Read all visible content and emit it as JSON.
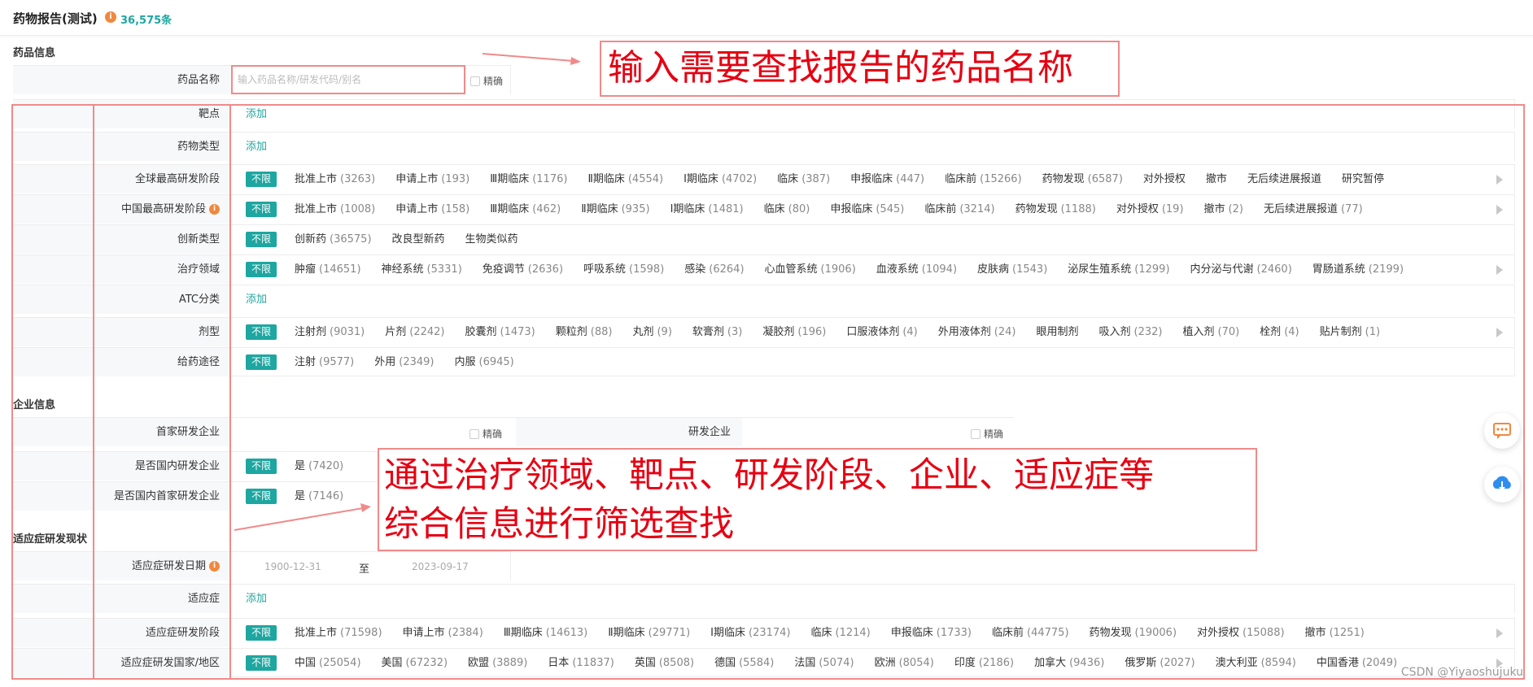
{
  "header": {
    "title": "药物报告(测试)",
    "info_icon": "i",
    "count": "36,575条"
  },
  "sections": {
    "drug_info": "药品信息",
    "company_info": "企业信息",
    "indication_info": "适应症研发现状"
  },
  "drug_name": {
    "label": "药品名称",
    "placeholder": "输入药品名称/研发代码/别名",
    "exact_label": "精确"
  },
  "common": {
    "all_label": "不限",
    "add_label": "添加",
    "to_label": "至"
  },
  "rows": {
    "target": {
      "label": "靶点"
    },
    "drug_type": {
      "label": "药物类型"
    },
    "global_stage": {
      "label": "全球最高研发阶段",
      "options": [
        {
          "name": "批准上市",
          "count": "(3263)"
        },
        {
          "name": "申请上市",
          "count": "(193)"
        },
        {
          "name": "Ⅲ期临床",
          "count": "(1176)"
        },
        {
          "name": "Ⅱ期临床",
          "count": "(4554)"
        },
        {
          "name": "Ⅰ期临床",
          "count": "(4702)"
        },
        {
          "name": "临床",
          "count": "(387)"
        },
        {
          "name": "申报临床",
          "count": "(447)"
        },
        {
          "name": "临床前",
          "count": "(15266)"
        },
        {
          "name": "药物发现",
          "count": "(6587)"
        },
        {
          "name": "对外授权",
          "count": ""
        },
        {
          "name": "撤市",
          "count": ""
        },
        {
          "name": "无后续进展报道",
          "count": ""
        },
        {
          "name": "研究暂停",
          "count": ""
        }
      ]
    },
    "china_stage": {
      "label": "中国最高研发阶段",
      "options": [
        {
          "name": "批准上市",
          "count": "(1008)"
        },
        {
          "name": "申请上市",
          "count": "(158)"
        },
        {
          "name": "Ⅲ期临床",
          "count": "(462)"
        },
        {
          "name": "Ⅱ期临床",
          "count": "(935)"
        },
        {
          "name": "Ⅰ期临床",
          "count": "(1481)"
        },
        {
          "name": "临床",
          "count": "(80)"
        },
        {
          "name": "申报临床",
          "count": "(545)"
        },
        {
          "name": "临床前",
          "count": "(3214)"
        },
        {
          "name": "药物发现",
          "count": "(1188)"
        },
        {
          "name": "对外授权",
          "count": "(19)"
        },
        {
          "name": "撤市",
          "count": "(2)"
        },
        {
          "name": "无后续进展报道",
          "count": "(77)"
        }
      ]
    },
    "innovation": {
      "label": "创新类型",
      "options": [
        {
          "name": "创新药",
          "count": "(36575)"
        },
        {
          "name": "改良型新药",
          "count": ""
        },
        {
          "name": "生物类似药",
          "count": ""
        }
      ]
    },
    "therapy_area": {
      "label": "治疗领域",
      "options": [
        {
          "name": "肿瘤",
          "count": "(14651)"
        },
        {
          "name": "神经系统",
          "count": "(5331)"
        },
        {
          "name": "免疫调节",
          "count": "(2636)"
        },
        {
          "name": "呼吸系统",
          "count": "(1598)"
        },
        {
          "name": "感染",
          "count": "(6264)"
        },
        {
          "name": "心血管系统",
          "count": "(1906)"
        },
        {
          "name": "血液系统",
          "count": "(1094)"
        },
        {
          "name": "皮肤病",
          "count": "(1543)"
        },
        {
          "name": "泌尿生殖系统",
          "count": "(1299)"
        },
        {
          "name": "内分泌与代谢",
          "count": "(2460)"
        },
        {
          "name": "胃肠道系统",
          "count": "(2199)"
        }
      ]
    },
    "atc": {
      "label": "ATC分类"
    },
    "dosage_form": {
      "label": "剂型",
      "options": [
        {
          "name": "注射剂",
          "count": "(9031)"
        },
        {
          "name": "片剂",
          "count": "(2242)"
        },
        {
          "name": "胶囊剂",
          "count": "(1473)"
        },
        {
          "name": "颗粒剂",
          "count": "(88)"
        },
        {
          "name": "丸剂",
          "count": "(9)"
        },
        {
          "name": "软膏剂",
          "count": "(3)"
        },
        {
          "name": "凝胶剂",
          "count": "(196)"
        },
        {
          "name": "口服液体剂",
          "count": "(4)"
        },
        {
          "name": "外用液体剂",
          "count": "(24)"
        },
        {
          "name": "眼用制剂",
          "count": ""
        },
        {
          "name": "吸入剂",
          "count": "(232)"
        },
        {
          "name": "植入剂",
          "count": "(70)"
        },
        {
          "name": "栓剂",
          "count": "(4)"
        },
        {
          "name": "贴片制剂",
          "count": "(1)"
        }
      ]
    },
    "route": {
      "label": "给药途径",
      "options": [
        {
          "name": "注射",
          "count": "(9577)"
        },
        {
          "name": "外用",
          "count": "(2349)"
        },
        {
          "name": "内服",
          "count": "(6945)"
        }
      ]
    },
    "first_company": {
      "label": "首家研发企业",
      "exact_label": "精确"
    },
    "rd_company": {
      "label": "研发企业",
      "exact_label": "精确"
    },
    "domestic_company": {
      "label": "是否国内研发企业",
      "options": [
        {
          "name": "是",
          "count": "(7420)"
        }
      ]
    },
    "domestic_first": {
      "label": "是否国内首家研发企业",
      "options": [
        {
          "name": "是",
          "count": "(7146)"
        }
      ]
    },
    "indication_date": {
      "label": "适应症研发日期",
      "start": "1900-12-31",
      "end": "2023-09-17"
    },
    "indication": {
      "label": "适应症"
    },
    "indication_stage": {
      "label": "适应症研发阶段",
      "options": [
        {
          "name": "批准上市",
          "count": "(71598)"
        },
        {
          "name": "申请上市",
          "count": "(2384)"
        },
        {
          "name": "Ⅲ期临床",
          "count": "(14613)"
        },
        {
          "name": "Ⅱ期临床",
          "count": "(29771)"
        },
        {
          "name": "Ⅰ期临床",
          "count": "(23174)"
        },
        {
          "name": "临床",
          "count": "(1214)"
        },
        {
          "name": "申报临床",
          "count": "(1733)"
        },
        {
          "name": "临床前",
          "count": "(44775)"
        },
        {
          "name": "药物发现",
          "count": "(19006)"
        },
        {
          "name": "对外授权",
          "count": "(15088)"
        },
        {
          "name": "撤市",
          "count": "(1251)"
        }
      ]
    },
    "indication_country": {
      "label": "适应症研发国家/地区",
      "options": [
        {
          "name": "中国",
          "count": "(25054)"
        },
        {
          "name": "美国",
          "count": "(67232)"
        },
        {
          "name": "欧盟",
          "count": "(3889)"
        },
        {
          "name": "日本",
          "count": "(11837)"
        },
        {
          "name": "英国",
          "count": "(8508)"
        },
        {
          "name": "德国",
          "count": "(5584)"
        },
        {
          "name": "法国",
          "count": "(5074)"
        },
        {
          "name": "欧洲",
          "count": "(8054)"
        },
        {
          "name": "印度",
          "count": "(2186)"
        },
        {
          "name": "加拿大",
          "count": "(9436)"
        },
        {
          "name": "俄罗斯",
          "count": "(2027)"
        },
        {
          "name": "澳大利亚",
          "count": "(8594)"
        },
        {
          "name": "中国香港",
          "count": "(2049)"
        }
      ]
    }
  },
  "annotations": {
    "top": "输入需要查找报告的药品名称",
    "middle_line1": "通过治疗领域、靶点、研发阶段、企业、适应症等",
    "middle_line2": "综合信息进行筛选查找"
  },
  "watermark": "CSDN @Yiyaoshujuku",
  "colors": {
    "accent": "#1ea6a0",
    "annotation_red": "#e60012",
    "frame_red": "#f08a8a",
    "info_orange": "#f0883e"
  },
  "icons": [
    "info-icon",
    "arrow-right-icon",
    "chat-icon",
    "cloud-download-icon",
    "checkbox-icon"
  ]
}
